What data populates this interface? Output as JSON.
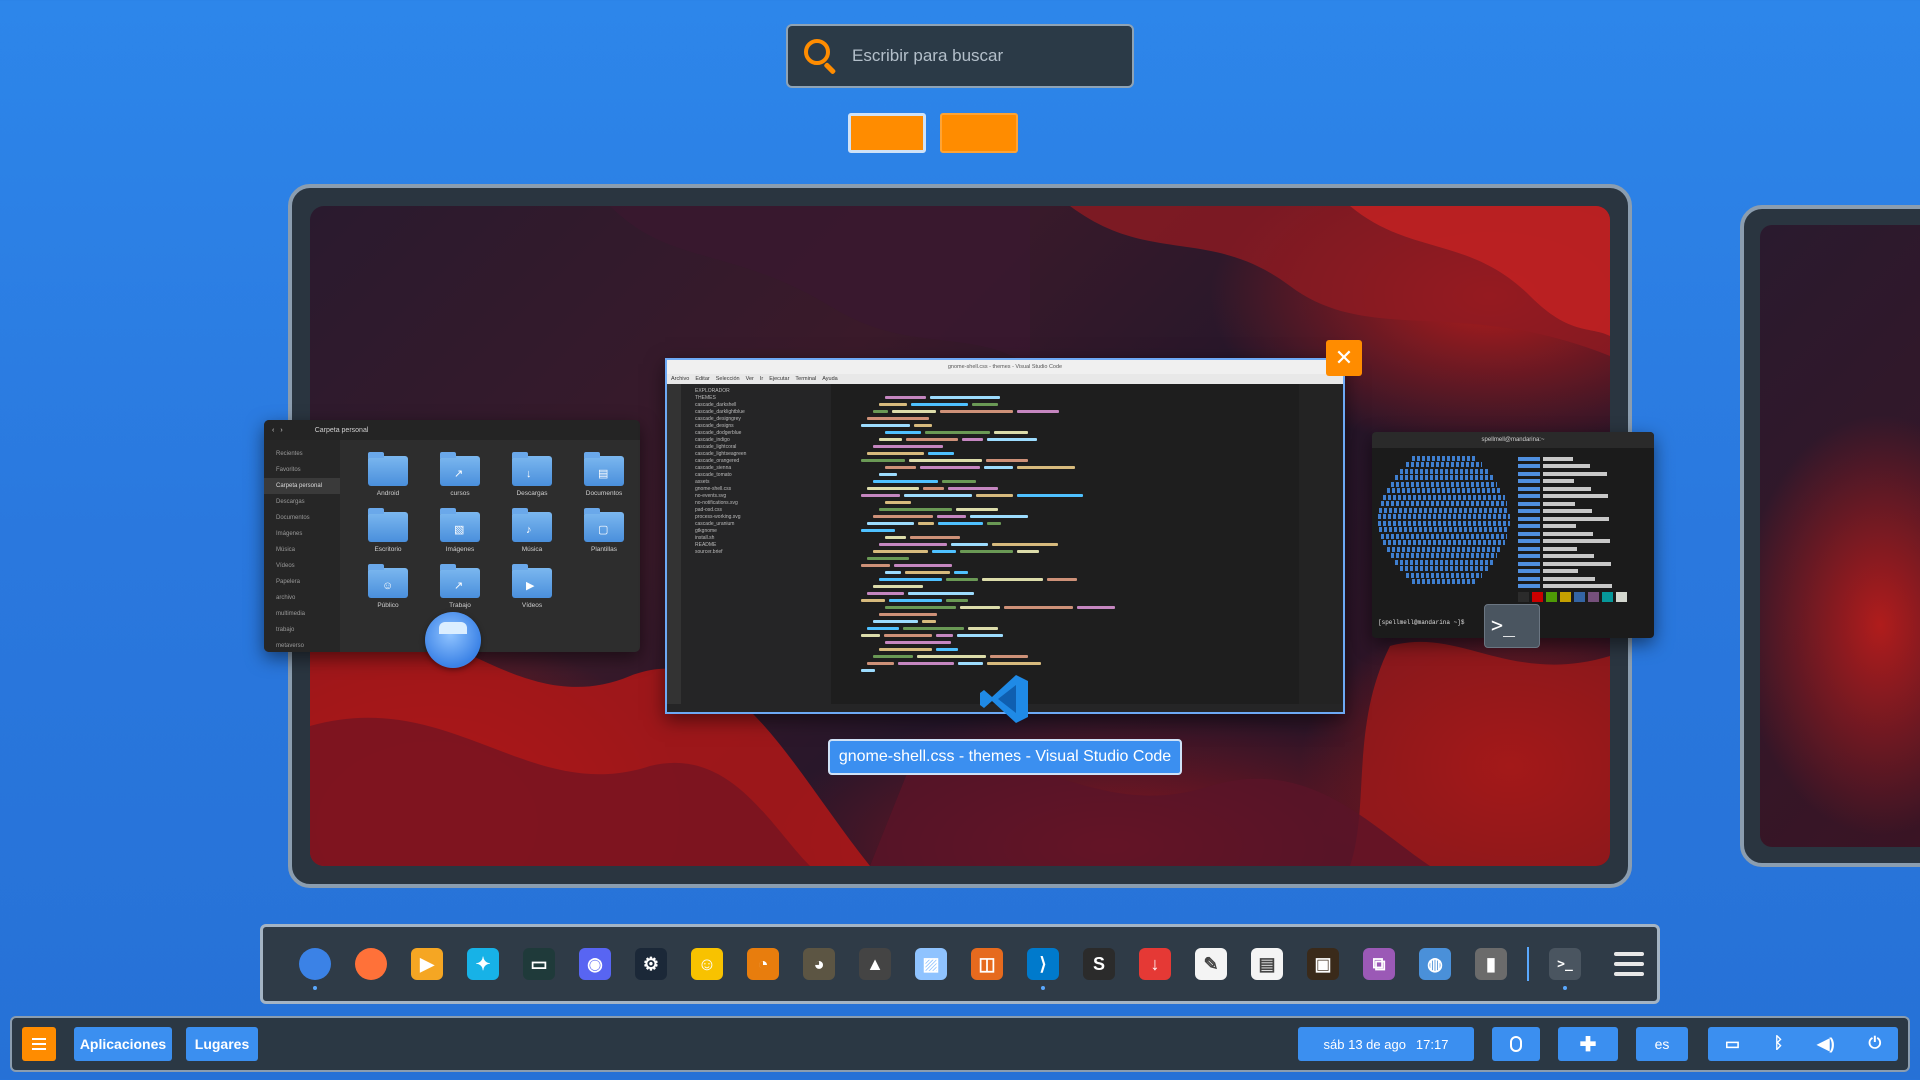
{
  "search": {
    "placeholder": "Escribir para buscar"
  },
  "workspace_switcher": {
    "count": 2,
    "active_index": 0
  },
  "windows": {
    "files": {
      "title": "Carpeta personal",
      "sidebar": [
        "Recientes",
        "Favoritos",
        "Carpeta personal",
        "Descargas",
        "Documentos",
        "Imágenes",
        "Música",
        "Vídeos",
        "Papelera",
        "archivo",
        "multimedia",
        "trabajo",
        "metaverso"
      ],
      "folders": [
        {
          "name": "Android",
          "glyph": ""
        },
        {
          "name": "cursos",
          "glyph": "↗"
        },
        {
          "name": "Descargas",
          "glyph": "↓"
        },
        {
          "name": "Documentos",
          "glyph": "▤"
        },
        {
          "name": "Escritorio",
          "glyph": ""
        },
        {
          "name": "Imágenes",
          "glyph": "▧"
        },
        {
          "name": "Música",
          "glyph": "♪"
        },
        {
          "name": "Plantillas",
          "glyph": "▢"
        },
        {
          "name": "Público",
          "glyph": "☺"
        },
        {
          "name": "Trabajo",
          "glyph": "↗"
        },
        {
          "name": "Vídeos",
          "glyph": "▶"
        }
      ]
    },
    "vscode": {
      "title": "gnome-shell.css - themes - Visual Studio Code",
      "menu": [
        "Archivo",
        "Editar",
        "Selección",
        "Ver",
        "Ir",
        "Ejecutar",
        "Terminal",
        "Ayuda"
      ],
      "explorer": [
        "EXPLORADOR",
        "THEMES",
        "cascade_darkshell",
        "cascade_darklightblue",
        "cascade_designgrey",
        "cascade_designs",
        "cascade_dodgerblue",
        "cascade_indigo",
        "cascade_lightcoral",
        "cascade_lightseagreen",
        "cascade_orangered",
        "cascade_sienna",
        "cascade_tomato",
        "assets",
        "gnome-shell.css",
        "no-events.svg",
        "no-notifications.svg",
        "pad-osd.css",
        "process-working.svg",
        "cascade_uranium",
        "gtkgnome",
        "install.sh",
        "README",
        "sourcer.brief"
      ]
    },
    "terminal": {
      "title": "spellmell@mandarina:~",
      "prompt": "[spellmell@mandarina ~]$"
    }
  },
  "dock": {
    "items": [
      {
        "name": "files",
        "color": "#3b82e6",
        "glyph": "",
        "running": true
      },
      {
        "name": "firefox",
        "color": "#ff7139",
        "glyph": "",
        "running": false
      },
      {
        "name": "media-player",
        "color": "#f5a623",
        "glyph": "▶",
        "running": false
      },
      {
        "name": "kodi",
        "color": "#17b2e7",
        "glyph": "✦",
        "running": false
      },
      {
        "name": "terminal-green",
        "color": "#1f3a3a",
        "glyph": "▭",
        "running": false
      },
      {
        "name": "discord",
        "color": "#5865f2",
        "glyph": "◉",
        "running": false
      },
      {
        "name": "steam",
        "color": "#1b2838",
        "glyph": "⚙",
        "running": false
      },
      {
        "name": "chat",
        "color": "#f8c200",
        "glyph": "☺",
        "running": false
      },
      {
        "name": "blender",
        "color": "#e87d0d",
        "glyph": "◔",
        "running": false
      },
      {
        "name": "gimp",
        "color": "#5c5543",
        "glyph": "◕",
        "running": false
      },
      {
        "name": "inkscape",
        "color": "#444444",
        "glyph": "▲",
        "running": false
      },
      {
        "name": "image-viewer",
        "color": "#8fc3ff",
        "glyph": "▨",
        "running": false
      },
      {
        "name": "screenshot",
        "color": "#e66a1e",
        "glyph": "◫",
        "running": false
      },
      {
        "name": "vscode",
        "color": "#007acc",
        "glyph": "⟩",
        "running": true
      },
      {
        "name": "skype",
        "color": "#2b2b2b",
        "glyph": "S",
        "running": false
      },
      {
        "name": "downloader",
        "color": "#e53935",
        "glyph": "↓",
        "running": false
      },
      {
        "name": "text-editor",
        "color": "#f4f4f4",
        "glyph": "✎",
        "running": false
      },
      {
        "name": "calculator",
        "color": "#f4f4f4",
        "glyph": "▤",
        "running": false
      },
      {
        "name": "pyxel",
        "color": "#3a2a1a",
        "glyph": "▣",
        "running": false
      },
      {
        "name": "crop-tool",
        "color": "#9b59b6",
        "glyph": "⧉",
        "running": false
      },
      {
        "name": "control-center",
        "color": "#4a90d9",
        "glyph": "◍",
        "running": false
      },
      {
        "name": "usb-drive",
        "color": "#6b6b6b",
        "glyph": "▮",
        "running": false
      }
    ],
    "pinned_terminal": {
      "name": "terminal",
      "running": true
    }
  },
  "panel": {
    "apps_label": "Aplicaciones",
    "places_label": "Lugares",
    "clock_date": "sáb 13 de ago",
    "clock_time": "17:17",
    "lang": "es"
  },
  "colors": {
    "accent": "#3b8ff0",
    "highlight": "#ff8c00",
    "panel_bg": "#2b3844"
  }
}
